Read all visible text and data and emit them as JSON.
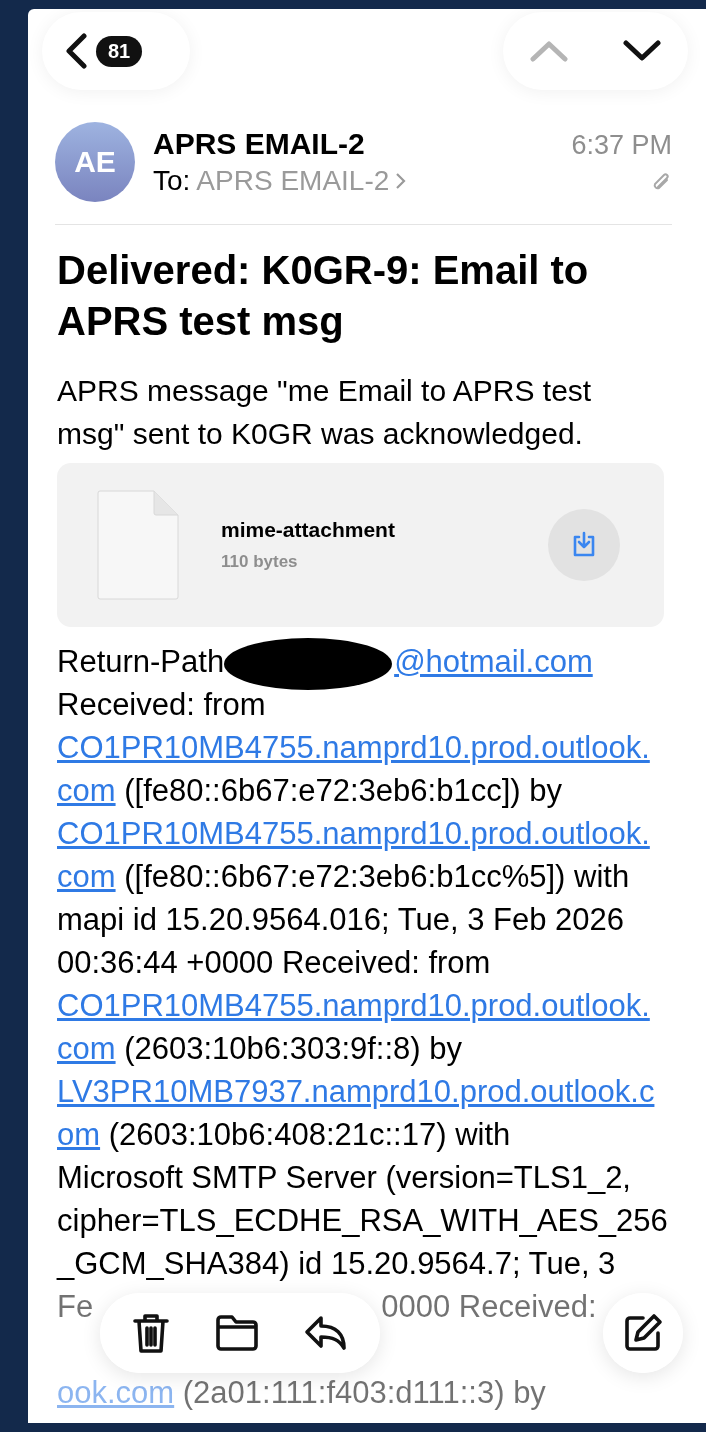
{
  "nav": {
    "unread_count": "81",
    "previous_enabled": false,
    "next_enabled": true
  },
  "message": {
    "avatar_initials": "AE",
    "sender": "APRS EMAIL-2",
    "to_label": "To:",
    "recipient": "APRS EMAIL-2",
    "time": "6:37 PM",
    "has_attachment": true,
    "subject": "Delivered: K0GR-9: Email to APRS test msg",
    "intro": "APRS message \"me Email to APRS test msg\" sent to K0GR was acknowledged.",
    "attachment": {
      "name": "mime-attachment",
      "size": "110 bytes"
    },
    "body_lines": [
      {
        "faded": false,
        "segments": [
          {
            "kind": "text",
            "text": "Return-Path"
          },
          {
            "kind": "redaction"
          },
          {
            "kind": "link",
            "text": "@hotmail.com"
          }
        ]
      },
      {
        "faded": false,
        "segments": [
          {
            "kind": "text",
            "text": "Received: from"
          }
        ]
      },
      {
        "faded": false,
        "segments": [
          {
            "kind": "link",
            "text": "CO1PR10MB4755.namprd10.prod.outlook."
          }
        ]
      },
      {
        "faded": false,
        "segments": [
          {
            "kind": "link",
            "text": "com"
          },
          {
            "kind": "text",
            "text": " ([fe80::6b67:e72:3eb6:b1cc]) by"
          }
        ]
      },
      {
        "faded": false,
        "segments": [
          {
            "kind": "link",
            "text": "CO1PR10MB4755.namprd10.prod.outlook."
          }
        ]
      },
      {
        "faded": false,
        "segments": [
          {
            "kind": "link",
            "text": "com"
          },
          {
            "kind": "text",
            "text": " ([fe80::6b67:e72:3eb6:b1cc%5]) with"
          }
        ]
      },
      {
        "faded": false,
        "segments": [
          {
            "kind": "text",
            "text": "mapi id 15.20.9564.016; Tue, 3 Feb 2026"
          }
        ]
      },
      {
        "faded": false,
        "segments": [
          {
            "kind": "text",
            "text": "00:36:44 +0000 Received: from"
          }
        ]
      },
      {
        "faded": false,
        "segments": [
          {
            "kind": "link",
            "text": "CO1PR10MB4755.namprd10.prod.outlook."
          }
        ]
      },
      {
        "faded": false,
        "segments": [
          {
            "kind": "link",
            "text": "com"
          },
          {
            "kind": "text",
            "text": " (2603:10b6:303:9f::8) by"
          }
        ]
      },
      {
        "faded": false,
        "segments": [
          {
            "kind": "link",
            "text": "LV3PR10MB7937.namprd10.prod.outlook.c"
          }
        ]
      },
      {
        "faded": false,
        "segments": [
          {
            "kind": "link",
            "text": "om"
          },
          {
            "kind": "text",
            "text": " (2603:10b6:408:21c::17) with"
          }
        ]
      },
      {
        "faded": false,
        "segments": [
          {
            "kind": "text",
            "text": "Microsoft SMTP Server (version=TLS1_2,"
          }
        ]
      },
      {
        "faded": false,
        "segments": [
          {
            "kind": "text",
            "text": "cipher=TLS_ECDHE_RSA_WITH_AES_256"
          }
        ]
      },
      {
        "faded": false,
        "segments": [
          {
            "kind": "text",
            "text": "_GCM_SHA384) id 15.20.9564.7; Tue, 3"
          }
        ]
      },
      {
        "faded": true,
        "segments": [
          {
            "kind": "text",
            "text": "Fe"
          },
          {
            "kind": "hidden"
          },
          {
            "kind": "text",
            "text": "0000 Received:"
          }
        ]
      },
      {
        "faded": true,
        "segments": [
          {
            "kind": "link",
            "text": "ook.com"
          },
          {
            "kind": "text",
            "text": " (2a01:111:f403:d111::3) by"
          }
        ]
      }
    ]
  }
}
